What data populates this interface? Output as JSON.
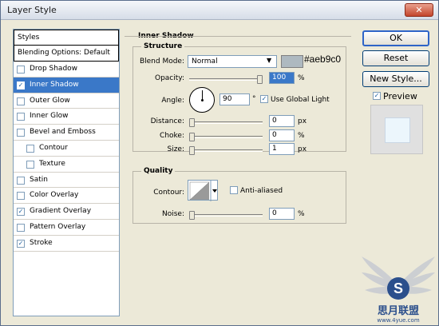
{
  "window": {
    "title": "Layer Style",
    "close_label": "✕"
  },
  "styles": {
    "header": "Styles",
    "blending": "Blending Options: Default",
    "items": [
      {
        "label": "Drop Shadow",
        "checked": false,
        "selected": false,
        "sub": false
      },
      {
        "label": "Inner Shadow",
        "checked": true,
        "selected": true,
        "sub": false
      },
      {
        "label": "Outer Glow",
        "checked": false,
        "selected": false,
        "sub": false
      },
      {
        "label": "Inner Glow",
        "checked": false,
        "selected": false,
        "sub": false
      },
      {
        "label": "Bevel and Emboss",
        "checked": false,
        "selected": false,
        "sub": false
      },
      {
        "label": "Contour",
        "checked": false,
        "selected": false,
        "sub": true
      },
      {
        "label": "Texture",
        "checked": false,
        "selected": false,
        "sub": true
      },
      {
        "label": "Satin",
        "checked": false,
        "selected": false,
        "sub": false
      },
      {
        "label": "Color Overlay",
        "checked": false,
        "selected": false,
        "sub": false
      },
      {
        "label": "Gradient Overlay",
        "checked": true,
        "selected": false,
        "sub": false
      },
      {
        "label": "Pattern Overlay",
        "checked": false,
        "selected": false,
        "sub": false
      },
      {
        "label": "Stroke",
        "checked": true,
        "selected": false,
        "sub": false
      }
    ]
  },
  "panel": {
    "title": "Inner Shadow",
    "structure": {
      "legend": "Structure",
      "blend_mode_label": "Blend Mode:",
      "blend_mode_value": "Normal",
      "color_hex": "#aeb9c0",
      "color_label": "#aeb9c0",
      "opacity_label": "Opacity:",
      "opacity_value": "100",
      "opacity_unit": "%",
      "opacity_level": 1.0,
      "angle_label": "Angle:",
      "angle_value": "90",
      "angle_unit": "°",
      "global_light_label": "Use Global Light",
      "global_light_checked": true,
      "distance_label": "Distance:",
      "distance_value": "0",
      "distance_unit": "px",
      "choke_label": "Choke:",
      "choke_value": "0",
      "choke_unit": "%",
      "size_label": "Size:",
      "size_value": "1",
      "size_unit": "px"
    },
    "quality": {
      "legend": "Quality",
      "contour_label": "Contour:",
      "anti_aliased_label": "Anti-aliased",
      "anti_aliased_checked": false,
      "noise_label": "Noise:",
      "noise_value": "0",
      "noise_unit": "%"
    }
  },
  "buttons": {
    "ok": "OK",
    "reset": "Reset",
    "new_style": "New Style...",
    "preview_label": "Preview",
    "preview_checked": true
  },
  "watermark": {
    "text": "思月联盟",
    "url": "www.4yue.com"
  },
  "colors": {
    "selection": "#3a78c8",
    "swatch": "#aeb9c0",
    "accent": "#2e64c8"
  }
}
